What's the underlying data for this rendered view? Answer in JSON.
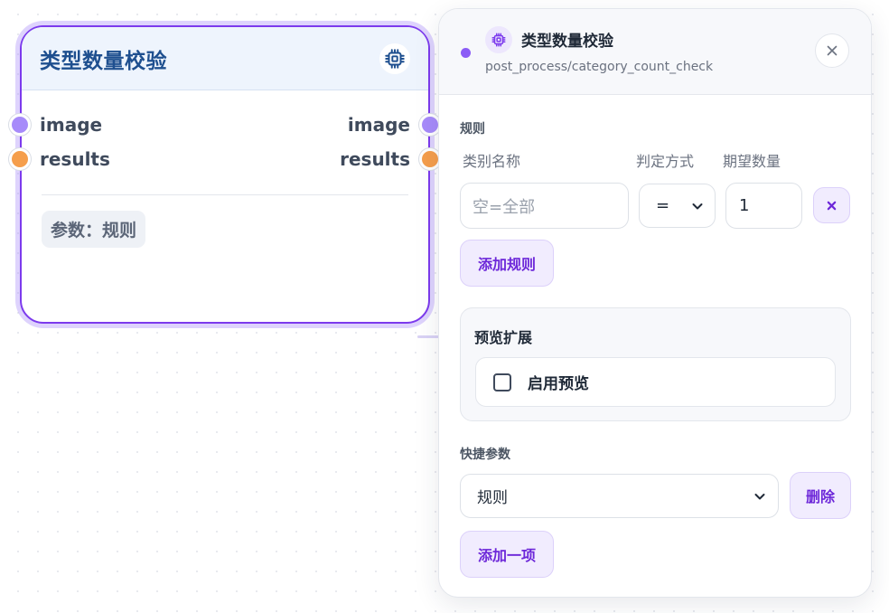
{
  "node": {
    "title": "类型数量校验",
    "icon": "chip-icon",
    "inputs": [
      "image",
      "results"
    ],
    "outputs": [
      "image",
      "results"
    ],
    "param_tag": "参数：规则",
    "port_colors": {
      "image": "#a78bfa",
      "results": "#f59e4c"
    }
  },
  "panel": {
    "title": "类型数量校验",
    "path": "post_process/category_count_check",
    "icon": "chip-icon",
    "status_color": "#8b5cf6",
    "close_icon": "close-icon",
    "rules": {
      "section_label": "规则",
      "col_name": "类别名称",
      "col_mode": "判定方式",
      "col_count": "期望数量",
      "row": {
        "name_placeholder": "空=全部",
        "name_value": "",
        "mode": "=",
        "count": "1"
      },
      "add_label": "添加规则"
    },
    "preview": {
      "section_label": "预览扩展",
      "checkbox_label": "启用预览",
      "checked": false
    },
    "quick": {
      "section_label": "快捷参数",
      "selected": "规则",
      "delete_label": "删除",
      "add_label": "添加一项"
    }
  }
}
